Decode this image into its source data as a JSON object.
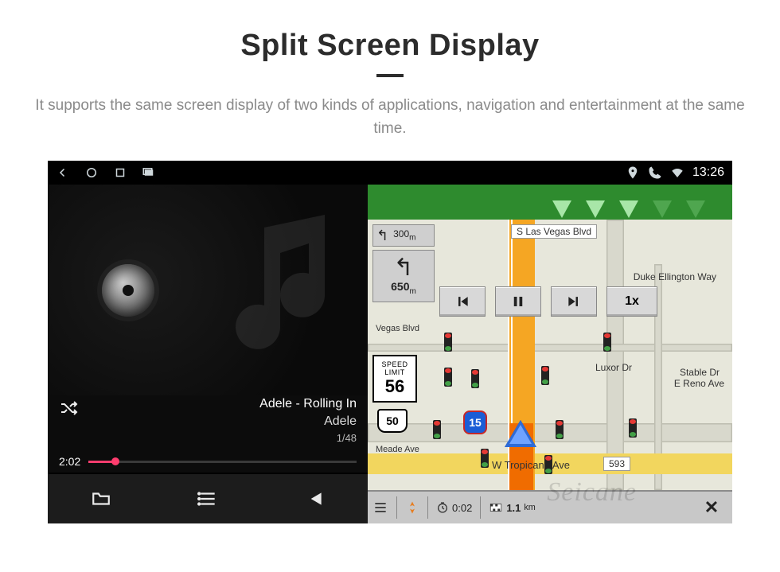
{
  "header": {
    "title": "Split Screen Display",
    "subtitle": "It supports the same screen display of two kinds of applications, navigation and entertainment at the same time."
  },
  "statusbar": {
    "time": "13:26"
  },
  "player": {
    "track_title": "Adele - Rolling In",
    "artist": "Adele",
    "counter": "1/48",
    "elapsed": "2:02"
  },
  "nav": {
    "street_top": "S Las Vegas Blvd",
    "street_right_1": "Duke Ellington Way",
    "street_right_2": "E Reno Ave",
    "street_bottom": "W Tropicana Ave",
    "vegas_label": "Vegas Blvd",
    "luxor_label": "Luxor Dr",
    "stable_label": "Stable Dr",
    "meade_label": "Meade Ave",
    "bottom_exit": "593",
    "turn_big_dist": "650",
    "turn_big_unit": "m",
    "turn_small_dist": "300",
    "turn_small_unit": "m",
    "speed_label_top": "SPEED",
    "speed_label_bot": "LIMIT",
    "speed_value": "56",
    "hwy_shield": "50",
    "interstate": "15",
    "sim_speed": "1x",
    "bottom_time": "0:02",
    "bottom_dist": "1.1",
    "bottom_dist_unit": "km"
  },
  "watermark": "Seicane"
}
